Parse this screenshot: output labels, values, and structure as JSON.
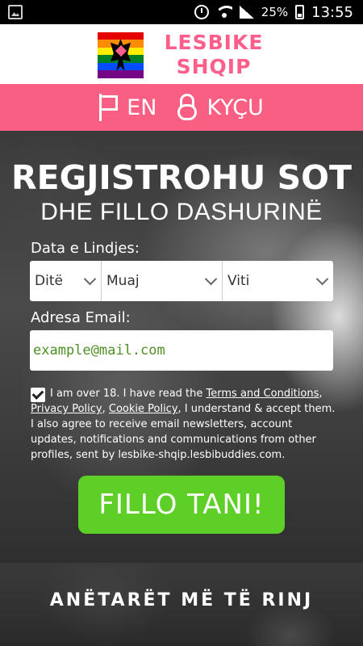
{
  "status_bar": {
    "battery": "25%",
    "time": "13:55"
  },
  "logo": {
    "line1": "LESBIKE",
    "line2": "SHQIP",
    "flag_colors": [
      "#e40303",
      "#ff8c00",
      "#ffed00",
      "#008026",
      "#004dff",
      "#750787"
    ]
  },
  "nav": {
    "language_label": "EN",
    "login_label": "KYÇU"
  },
  "hero": {
    "title": "REGJISTROHU SOT",
    "subtitle": "DHE FILLO DASHURINË"
  },
  "form": {
    "dob_label": "Data e Lindjes:",
    "day_select": "Ditë",
    "month_select": "Muaj",
    "year_select": "Viti",
    "email_label": "Adresa Email:",
    "email_placeholder": "example@mail.com",
    "consent_checked": true,
    "terms_prefix": "I am over 18. I have read the",
    "terms_link": "Terms and Conditions",
    "privacy_link": "Privacy Policy",
    "cookie_link": "Cookie Policy",
    "terms_suffix": ", I understand & accept them. I also agree to receive email newsletters, account updates, notifications and communications from other profiles, sent by lesbike-shqip.lesbibuddies.com.",
    "submit_label": "FILLO TANI!"
  },
  "members": {
    "title": "ANËTARËT MË TË RINJ"
  },
  "colors": {
    "brand_pink": "#f85f82",
    "cta_green": "#5ecf26"
  }
}
